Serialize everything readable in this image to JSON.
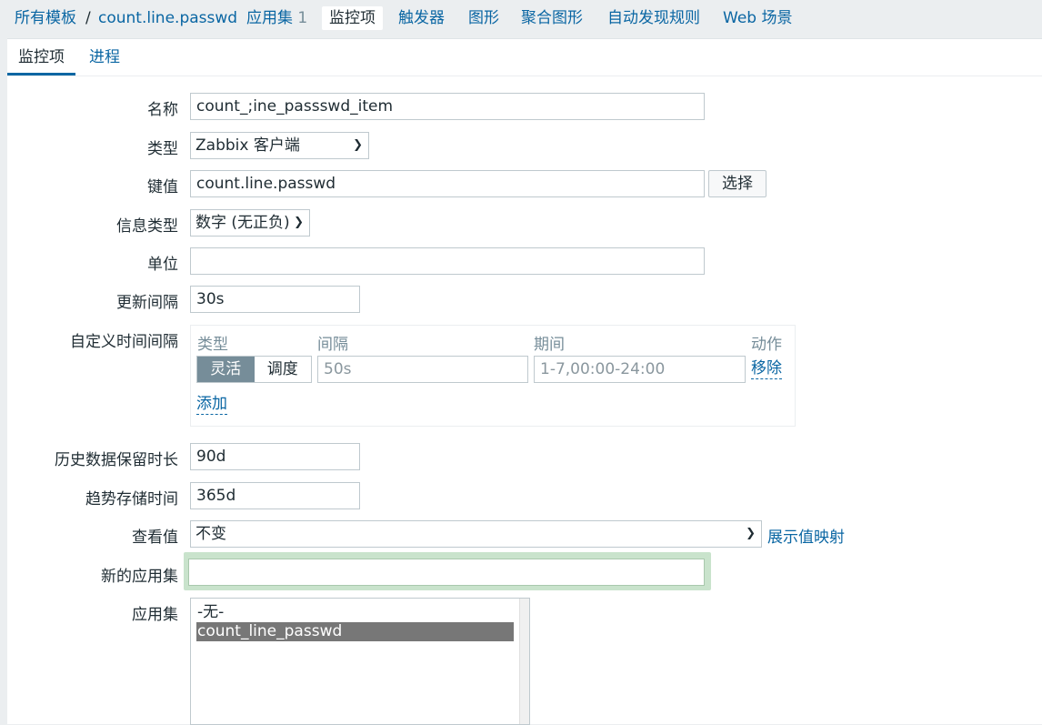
{
  "nav": {
    "all_templates": "所有模板",
    "separator": "/",
    "template": "count.line.passwd",
    "applications": "应用集",
    "applications_count": "1",
    "items": "监控项",
    "triggers": "触发器",
    "graphs": "图形",
    "screens": "聚合图形",
    "discovery": "自动发现规则",
    "web": "Web 场景"
  },
  "tabs": {
    "item": "监控项",
    "process": "进程"
  },
  "form": {
    "name_label": "名称",
    "name_value": "count_;ine_passswd_item",
    "type_label": "类型",
    "type_value": "Zabbix 客户端",
    "key_label": "键值",
    "key_value": "count.line.passwd",
    "select_button": "选择",
    "info_type_label": "信息类型",
    "info_type_value": "数字 (无正负)",
    "units_label": "单位",
    "units_value": "",
    "interval_label": "更新间隔",
    "interval_value": "30s",
    "custom_intervals_label": "自定义时间间隔",
    "custom_intervals": {
      "col_type": "类型",
      "col_interval": "间隔",
      "col_period": "期间",
      "col_action": "动作",
      "flexible": "灵活",
      "scheduling": "调度",
      "interval_placeholder": "50s",
      "period_placeholder": "1-7,00:00-24:00",
      "remove": "移除",
      "add": "添加"
    },
    "history_label": "历史数据保留时长",
    "history_value": "90d",
    "trends_label": "趋势存储时间",
    "trends_value": "365d",
    "valuemap_label": "查看值",
    "valuemap_value": "不变",
    "valuemap_link": "展示值映射",
    "new_app_label": "新的应用集",
    "new_app_value": "",
    "apps_label": "应用集",
    "apps_options": [
      "-无-",
      "count_line_passwd"
    ]
  },
  "colors": {
    "accent": "#0a66a3",
    "selected_bg": "#777777",
    "segment_on": "#768d99",
    "focus": "#c9e3cc"
  }
}
